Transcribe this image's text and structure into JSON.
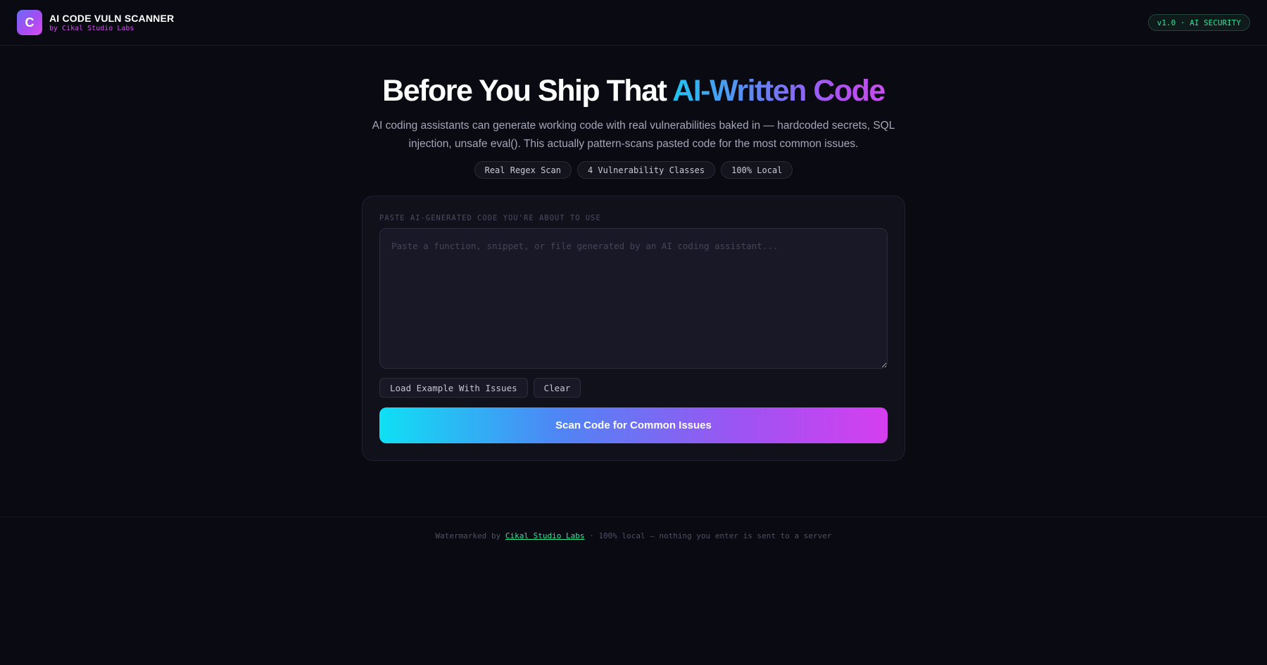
{
  "header": {
    "logo_letter": "C",
    "title": "AI CODE VULN SCANNER",
    "subtitle": "by Cikal Studio Labs",
    "version_badge": "v1.0 · AI SECURITY"
  },
  "hero": {
    "title_plain": "Before You Ship That ",
    "title_highlight": "AI-Written Code",
    "description": "AI coding assistants can generate working code with real vulnerabilities baked in — hardcoded secrets, SQL injection, unsafe eval(). This actually pattern-scans pasted code for the most common issues.",
    "chips": [
      "Real Regex Scan",
      "4 Vulnerability Classes",
      "100% Local"
    ]
  },
  "scanner": {
    "label": "PASTE AI-GENERATED CODE YOU'RE ABOUT TO USE",
    "input_value": "",
    "placeholder": "Paste a function, snippet, or file generated by an AI coding assistant...",
    "load_example_label": "Load Example With Issues",
    "clear_label": "Clear",
    "scan_label": "Scan Code for Common Issues"
  },
  "footer": {
    "prefix": "Watermarked by ",
    "link_text": "Cikal Studio Labs",
    "suffix": " · 100% local — nothing you enter is sent to a server"
  },
  "colors": {
    "background": "#0a0a12",
    "accent_green": "#2fe39a",
    "accent_magenta": "#d24ef0",
    "accent_cyan": "#0fe0f4"
  }
}
